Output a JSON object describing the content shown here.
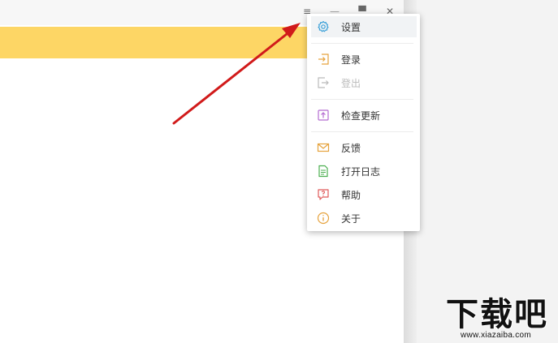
{
  "window": {
    "controls": [
      {
        "name": "menu-icon",
        "glyph": "≡"
      },
      {
        "name": "minimize-icon",
        "glyph": "—"
      },
      {
        "name": "maximize-icon",
        "glyph": "▀"
      },
      {
        "name": "close-icon",
        "glyph": "✕"
      }
    ]
  },
  "menu": {
    "items": [
      {
        "label": "设置",
        "icon": "gear-icon",
        "color": "#3aa0d8",
        "state": "hover"
      },
      {
        "label": "登录",
        "icon": "login-icon",
        "color": "#e6a23c",
        "state": "normal"
      },
      {
        "label": "登出",
        "icon": "logout-icon",
        "color": "#bbbbbb",
        "state": "disabled"
      },
      {
        "label": "检查更新",
        "icon": "update-icon",
        "color": "#b56cd1",
        "state": "normal"
      },
      {
        "label": "反馈",
        "icon": "mail-icon",
        "color": "#e6a23c",
        "state": "normal"
      },
      {
        "label": "打开日志",
        "icon": "document-icon",
        "color": "#4caf50",
        "state": "normal"
      },
      {
        "label": "帮助",
        "icon": "help-icon",
        "color": "#e05a5a",
        "state": "normal"
      },
      {
        "label": "关于",
        "icon": "info-icon",
        "color": "#e6a23c",
        "state": "normal"
      }
    ]
  },
  "colors": {
    "banner": "#fdd665",
    "arrow": "#d11a1a"
  },
  "watermark": {
    "main": "下载吧",
    "url": "www.xiazaiba.com"
  }
}
